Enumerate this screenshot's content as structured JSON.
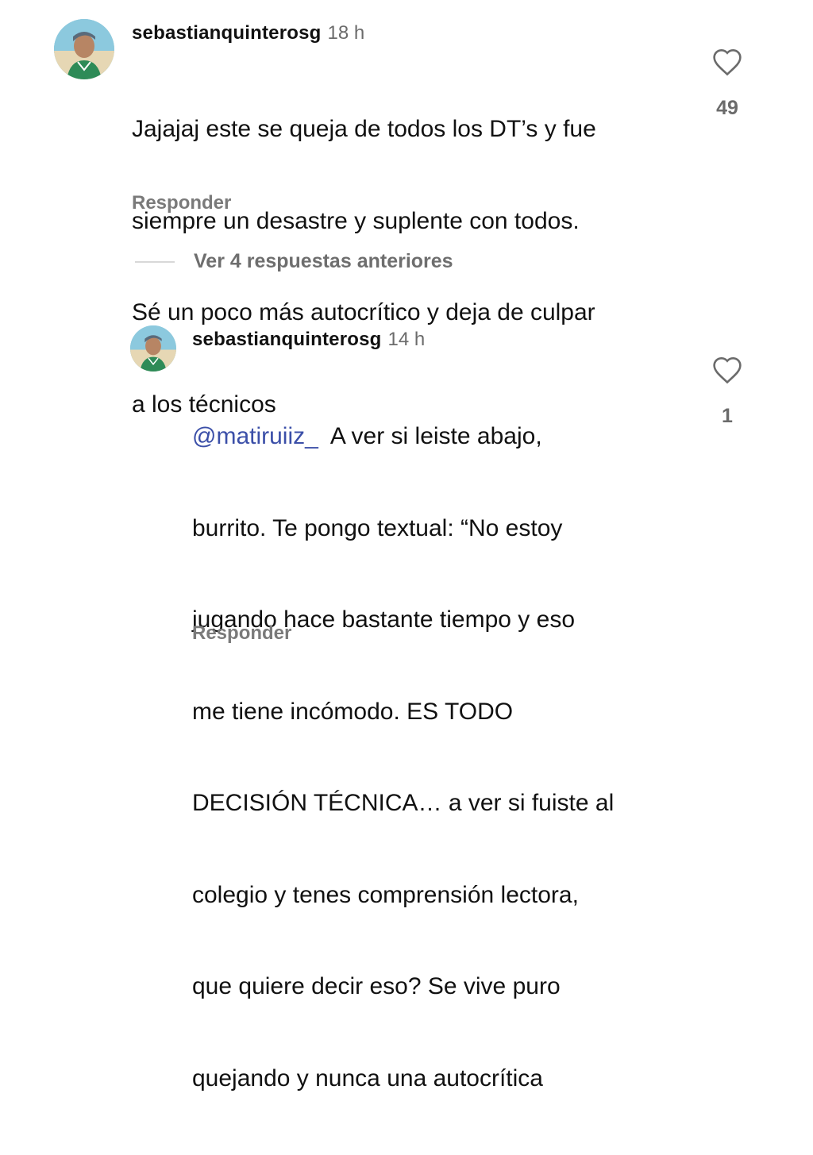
{
  "comments": [
    {
      "username": "sebastianquinterosg",
      "time": "18 h",
      "text_lines": [
        "Jajajaj este se queja de todos los DT’s y fue",
        "siempre un desastre y suplente con todos.",
        "Sé un poco más autocrítico y deja de culpar",
        "a los técnicos"
      ],
      "likes": "49",
      "reply_label": "Responder",
      "icon": "heart-outline-icon"
    },
    {
      "username": "sebastianquinterosg",
      "time": "14 h",
      "mention": "@matiruiiz_",
      "first_line_rest": "  A ver si leiste abajo,",
      "text_lines": [
        "burrito. Te pongo textual: “No estoy",
        "jugando hace bastante tiempo y eso",
        "me tiene incómodo. ES TODO",
        "DECISIÓN TÉCNICA… a ver si fuiste al",
        "colegio y tenes comprensión lectora,",
        "que quiere decir eso? Se vive puro",
        "quejando y nunca una autocrítica"
      ],
      "likes": "1",
      "reply_label": "Responder",
      "icon": "heart-outline-icon"
    }
  ],
  "view_replies": {
    "label": "Ver 4 respuestas anteriores"
  },
  "colors": {
    "mention": "#3b4fa8",
    "muted": "#6b6b6b",
    "text": "#111111"
  }
}
